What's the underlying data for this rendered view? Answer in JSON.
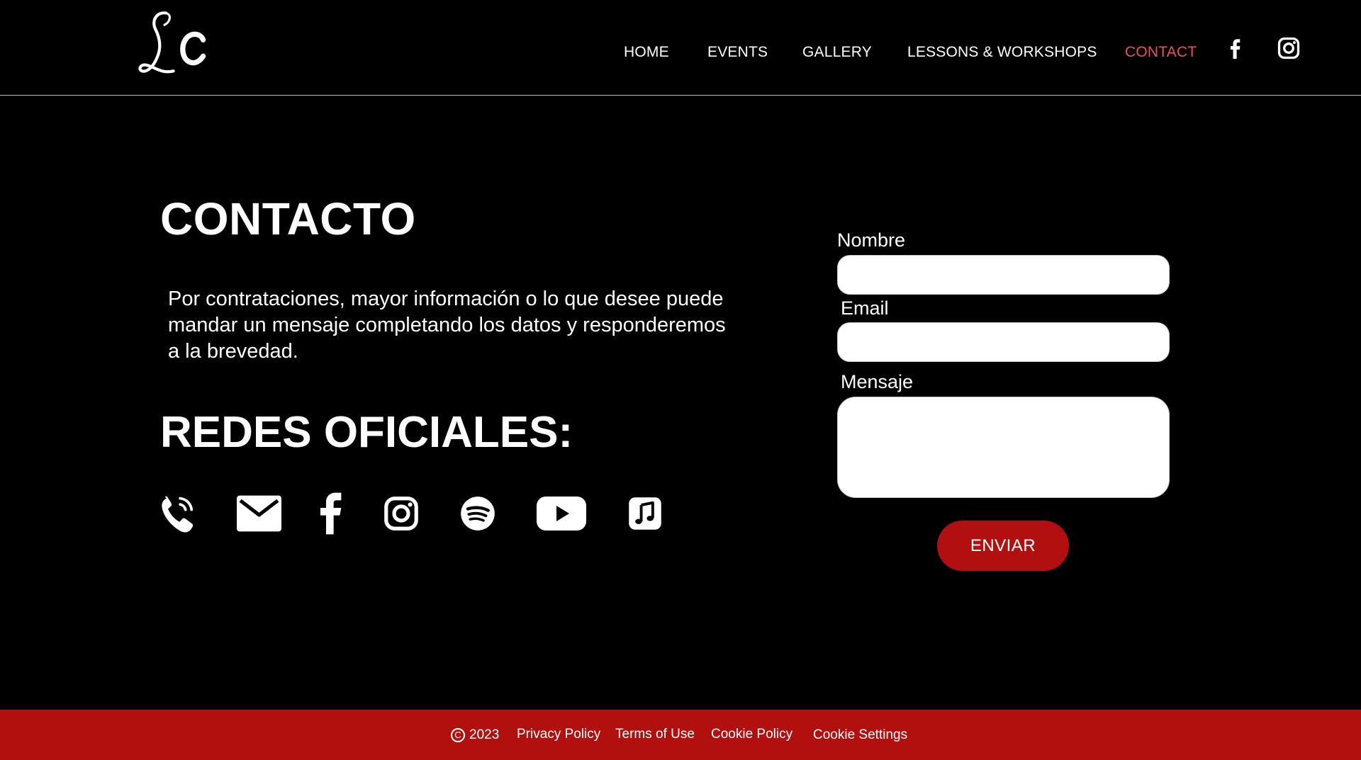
{
  "header": {
    "logo_text": "LC",
    "nav": [
      {
        "label": "HOME",
        "active": false
      },
      {
        "label": "EVENTS",
        "active": false
      },
      {
        "label": "GALLERY",
        "active": false
      },
      {
        "label": "LESSONS & WORKSHOPS",
        "active": false
      },
      {
        "label": "CONTACT",
        "active": true
      }
    ],
    "social_icons": [
      "facebook-icon",
      "instagram-icon"
    ]
  },
  "main": {
    "title": "CONTACTO",
    "description": "Por contrataciones, mayor información o lo que desee puede mandar un mensaje completando los datos y responderemos a la brevedad.",
    "social_title": "REDES OFICIALES:",
    "social_icons": [
      "phone-icon",
      "email-icon",
      "facebook-icon",
      "instagram-icon",
      "spotify-icon",
      "youtube-icon",
      "music-icon"
    ]
  },
  "form": {
    "name_label": "Nombre",
    "name_value": "",
    "email_label": "Email",
    "email_value": "",
    "message_label": "Mensaje",
    "message_value": "",
    "submit_label": "ENVIAR"
  },
  "footer": {
    "copyright_symbol": "C",
    "year": "2023",
    "links": [
      "Privacy Policy",
      "Terms of Use",
      "Cookie Policy",
      "Cookie Settings"
    ]
  },
  "colors": {
    "background": "#000000",
    "accent_red": "#b20f0f",
    "active_nav": "#e8525a",
    "text": "#ffffff"
  }
}
